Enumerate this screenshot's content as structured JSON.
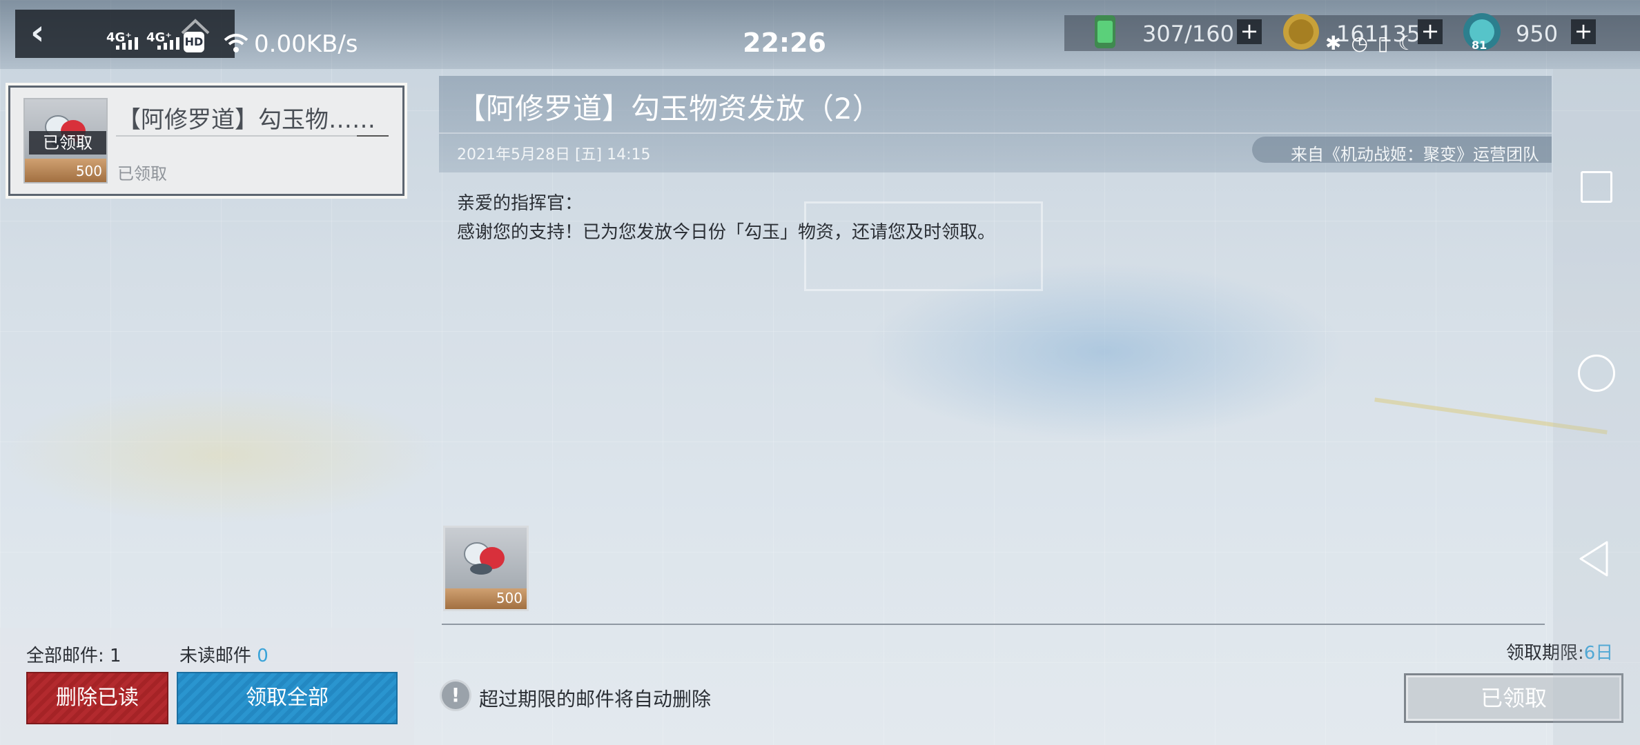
{
  "status_bar": {
    "signal_1": "4G⁺",
    "signal_2": "4G⁺",
    "hd_badge": "HD",
    "network_speed": "0.00KB/s",
    "time": "22:26",
    "icons": [
      "back-chevron-icon",
      "home-icon",
      "wifi-icon",
      "bluetooth-icon",
      "alarm-icon",
      "vibrate-icon",
      "moon-icon"
    ]
  },
  "resources": {
    "stamina": "307/160",
    "coins": "161135",
    "gems": "950",
    "level_badge": "81"
  },
  "mail_list": {
    "items": [
      {
        "title": "【阿修罗道】勾玉物……",
        "thumb_label": "已领取",
        "thumb_count": "500",
        "status": "已领取"
      }
    ]
  },
  "summary": {
    "total_label": "全部邮件:",
    "total_value": "1",
    "unread_label": "未读邮件",
    "unread_value": "0"
  },
  "buttons": {
    "delete_read": "删除已读",
    "claim_all": "领取全部",
    "claimed": "已领取"
  },
  "detail": {
    "title": "【阿修罗道】勾玉物资发放（2）",
    "date": "2021年5月28日 [五] 14:15",
    "sender": "来自《机动战姬：聚变》运营团队",
    "greeting": "亲爱的指挥官：",
    "body": "感谢您的支持！已为您发放今日份「勾玉」物资，还请您及时领取。",
    "attachment_count": "500",
    "deadline_label": "领取期限:",
    "deadline_value": "6日",
    "notice": "超过期限的邮件将自动删除"
  },
  "colors": {
    "delete_button": "#a52326",
    "claim_all_button": "#2388c2",
    "accent_blue": "#3aa3d8"
  }
}
